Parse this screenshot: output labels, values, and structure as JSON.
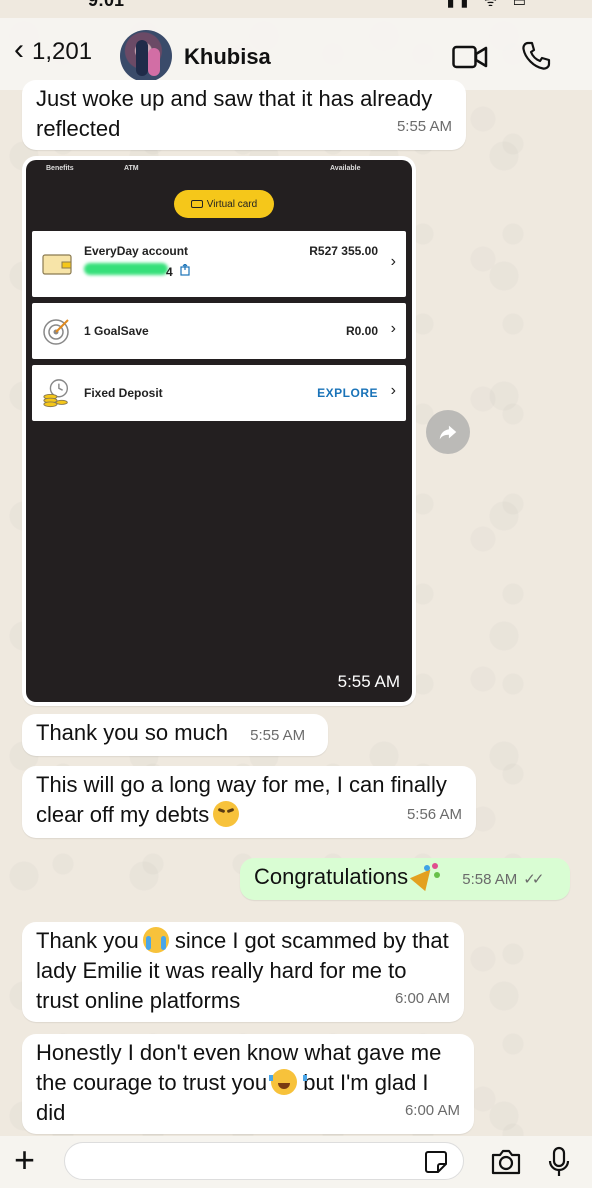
{
  "status_bar": {
    "time": "9:01",
    "icons": "▮▮ ᯤ ▭"
  },
  "header": {
    "back_count": "1,201",
    "contact_name": "Khubisa"
  },
  "messages": [
    {
      "id": "m1",
      "direction": "in",
      "text": "Just woke up and saw that it has already reflected",
      "time": "5:55 AM"
    },
    {
      "id": "m2",
      "direction": "in",
      "type": "image",
      "time": "5:55 AM",
      "image": {
        "top_labels": [
          "Benefits",
          "ATM",
          "Available"
        ],
        "virtual_card_label": "Virtual card",
        "accounts": [
          {
            "name": "EveryDay account",
            "value": "R527 355.00",
            "number_tail": "4"
          },
          {
            "name": "1 GoalSave",
            "value": "R0.00"
          },
          {
            "name": "Fixed Deposit",
            "value": "EXPLORE"
          }
        ]
      }
    },
    {
      "id": "m3",
      "direction": "in",
      "text": "Thank you so much",
      "time": "5:55 AM"
    },
    {
      "id": "m4",
      "direction": "in",
      "text": "This will go a long way for me, I can finally clear off my debts",
      "time": "5:56 AM",
      "emoji": "weary-face"
    },
    {
      "id": "m5",
      "direction": "out",
      "text": "Congratulations",
      "time": "5:58 AM",
      "emoji": "party-popper",
      "status": "read"
    },
    {
      "id": "m6",
      "direction": "in",
      "text_before": "Thank you",
      "emoji": "crying-face",
      "text_after": "since I got scammed by that lady  Emilie it was really hard for me to trust online platforms",
      "time": "6:00 AM"
    },
    {
      "id": "m7",
      "direction": "in",
      "text_before": "Honestly I don't even know what gave me the courage to trust you",
      "emoji": "tears-of-joy",
      "text_after": "but I'm glad I did",
      "time": "6:00 AM"
    }
  ],
  "input": {
    "value": "",
    "placeholder": ""
  }
}
